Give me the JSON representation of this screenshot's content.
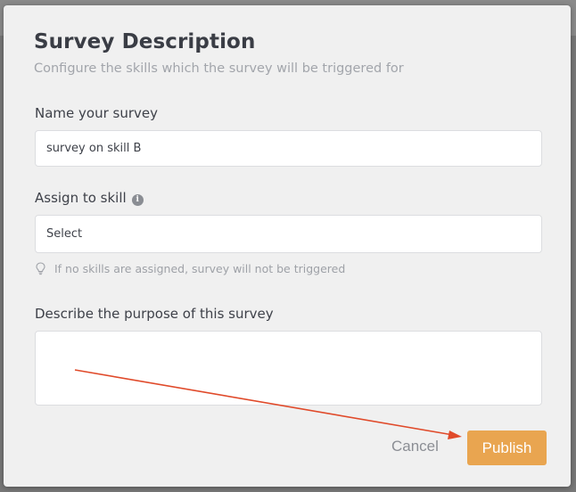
{
  "dialog": {
    "title": "Survey Description",
    "subtitle": "Configure the skills which the survey will be triggered for",
    "name_label": "Name your survey",
    "name_value": "survey on skill B",
    "skill_label": "Assign to skill",
    "skill_info_glyph": "i",
    "skill_select_value": "Select",
    "skill_hint": "If no skills are assigned, survey will not be triggered",
    "purpose_label": "Describe the purpose of this survey",
    "purpose_value": "",
    "cancel_label": "Cancel",
    "publish_label": "Publish"
  },
  "icons": {
    "info": "info-icon",
    "hint": "lightbulb-icon"
  },
  "colors": {
    "publish_button": "#e9a550",
    "annotation_arrow": "#e04a2a",
    "title_text": "#3a3d45",
    "muted_text": "#a2a5ab"
  }
}
